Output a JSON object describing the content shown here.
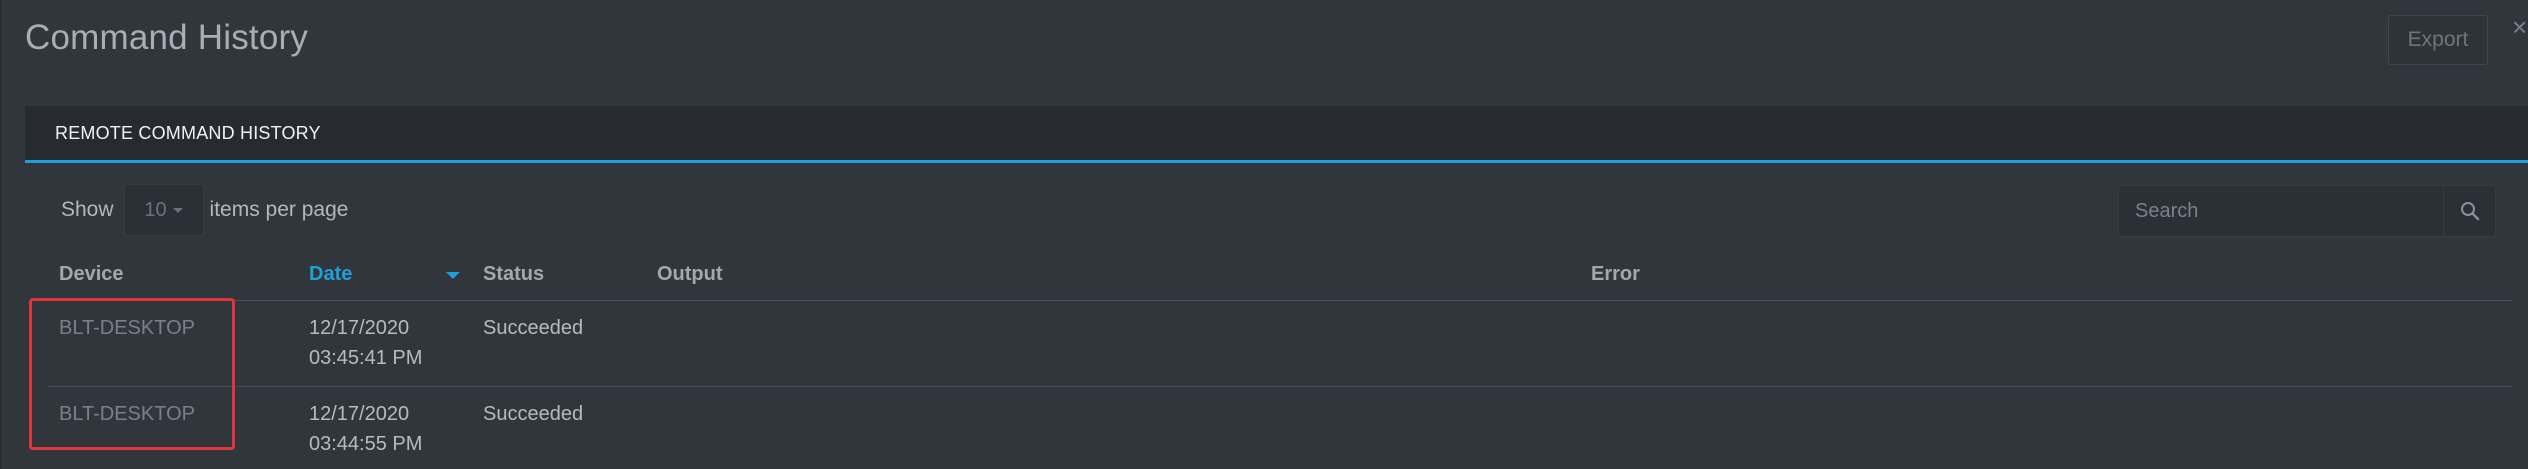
{
  "dialog": {
    "title": "Command History",
    "export_label": "Export",
    "close_symbol": "×"
  },
  "tabs": [
    {
      "label": "REMOTE COMMAND HISTORY",
      "active": true
    }
  ],
  "toolbar": {
    "show_label": "Show",
    "page_size": "10",
    "per_page_label": "items per page",
    "search_placeholder": "Search"
  },
  "table": {
    "columns": [
      "Device",
      "Date",
      "Status",
      "Output",
      "Error"
    ],
    "sorted_column": "Date",
    "sort_direction": "descending",
    "rows": [
      {
        "device": "BLT-DESKTOP",
        "date": "12/17/2020 03:45:41 PM",
        "status": "Succeeded",
        "output": "",
        "error": ""
      },
      {
        "device": "BLT-DESKTOP",
        "date": "12/17/2020 03:44:55 PM",
        "status": "Succeeded",
        "output": "",
        "error": ""
      }
    ]
  },
  "colors": {
    "background": "#31363d",
    "tab_bar": "#272b31",
    "accent": "#1ea0d8",
    "highlight": "#e2353b"
  },
  "icons": {
    "search": "search-icon",
    "close": "close-icon",
    "dropdown": "caret-down-icon",
    "sort": "sort-down-icon"
  }
}
